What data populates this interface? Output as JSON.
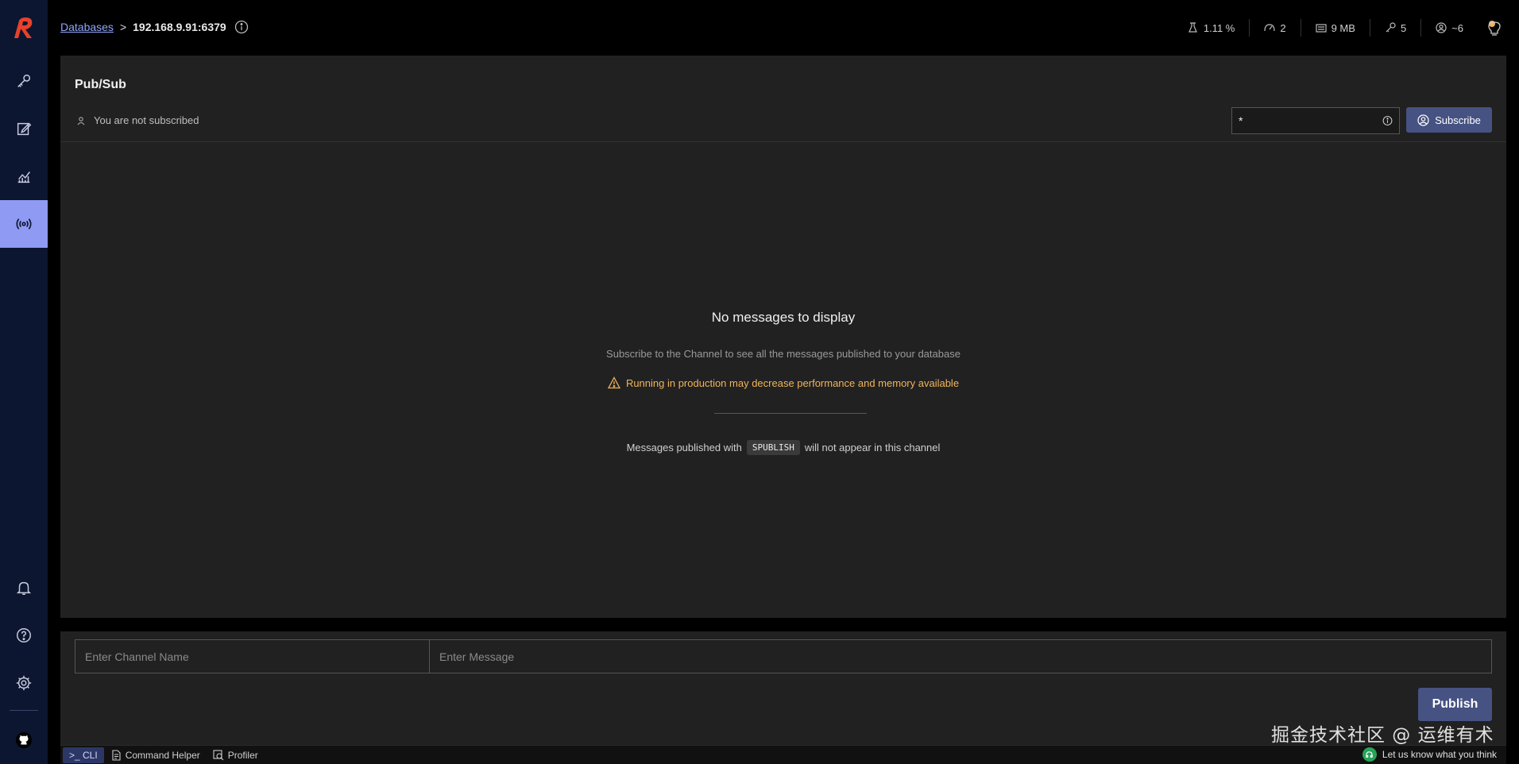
{
  "breadcrumb": {
    "databases": "Databases",
    "separator": ">",
    "current": "192.168.9.91:6379"
  },
  "stats": {
    "cpu": "1.11 %",
    "commands": "2",
    "memory": "9 MB",
    "keys": "5",
    "clients": "~6"
  },
  "page": {
    "title": "Pub/Sub",
    "status": "You are not subscribed"
  },
  "subscribe": {
    "pattern_value": "*",
    "button_label": "Subscribe"
  },
  "empty": {
    "title": "No messages to display",
    "subtitle": "Subscribe to the Channel to see all the messages published to your database",
    "warning": "Running in production may decrease performance and memory available",
    "note_before": "Messages published with",
    "code": "SPUBLISH",
    "note_after": "will not appear in this channel"
  },
  "publish": {
    "channel_placeholder": "Enter Channel Name",
    "message_placeholder": "Enter Message",
    "button_label": "Publish"
  },
  "watermark": "掘金技术社区 @ 运维有术",
  "bottombar": {
    "cli": ">_ CLI",
    "command_helper": "Command Helper",
    "profiler": "Profiler",
    "feedback": "Let us know what you think"
  },
  "colors": {
    "accent": "#8f9bf2",
    "sidebar": "#0d1630",
    "warning": "#f2b35a",
    "button": "#465282",
    "logo": "#e8412b"
  },
  "sidebar": {
    "icons": [
      "browser-key-icon",
      "workbench-edit-icon",
      "analytics-icon",
      "pubsub-broadcast-icon",
      "notification-bell-icon",
      "help-icon",
      "settings-gear-icon",
      "github-icon"
    ],
    "active": "pubsub-broadcast-icon"
  }
}
